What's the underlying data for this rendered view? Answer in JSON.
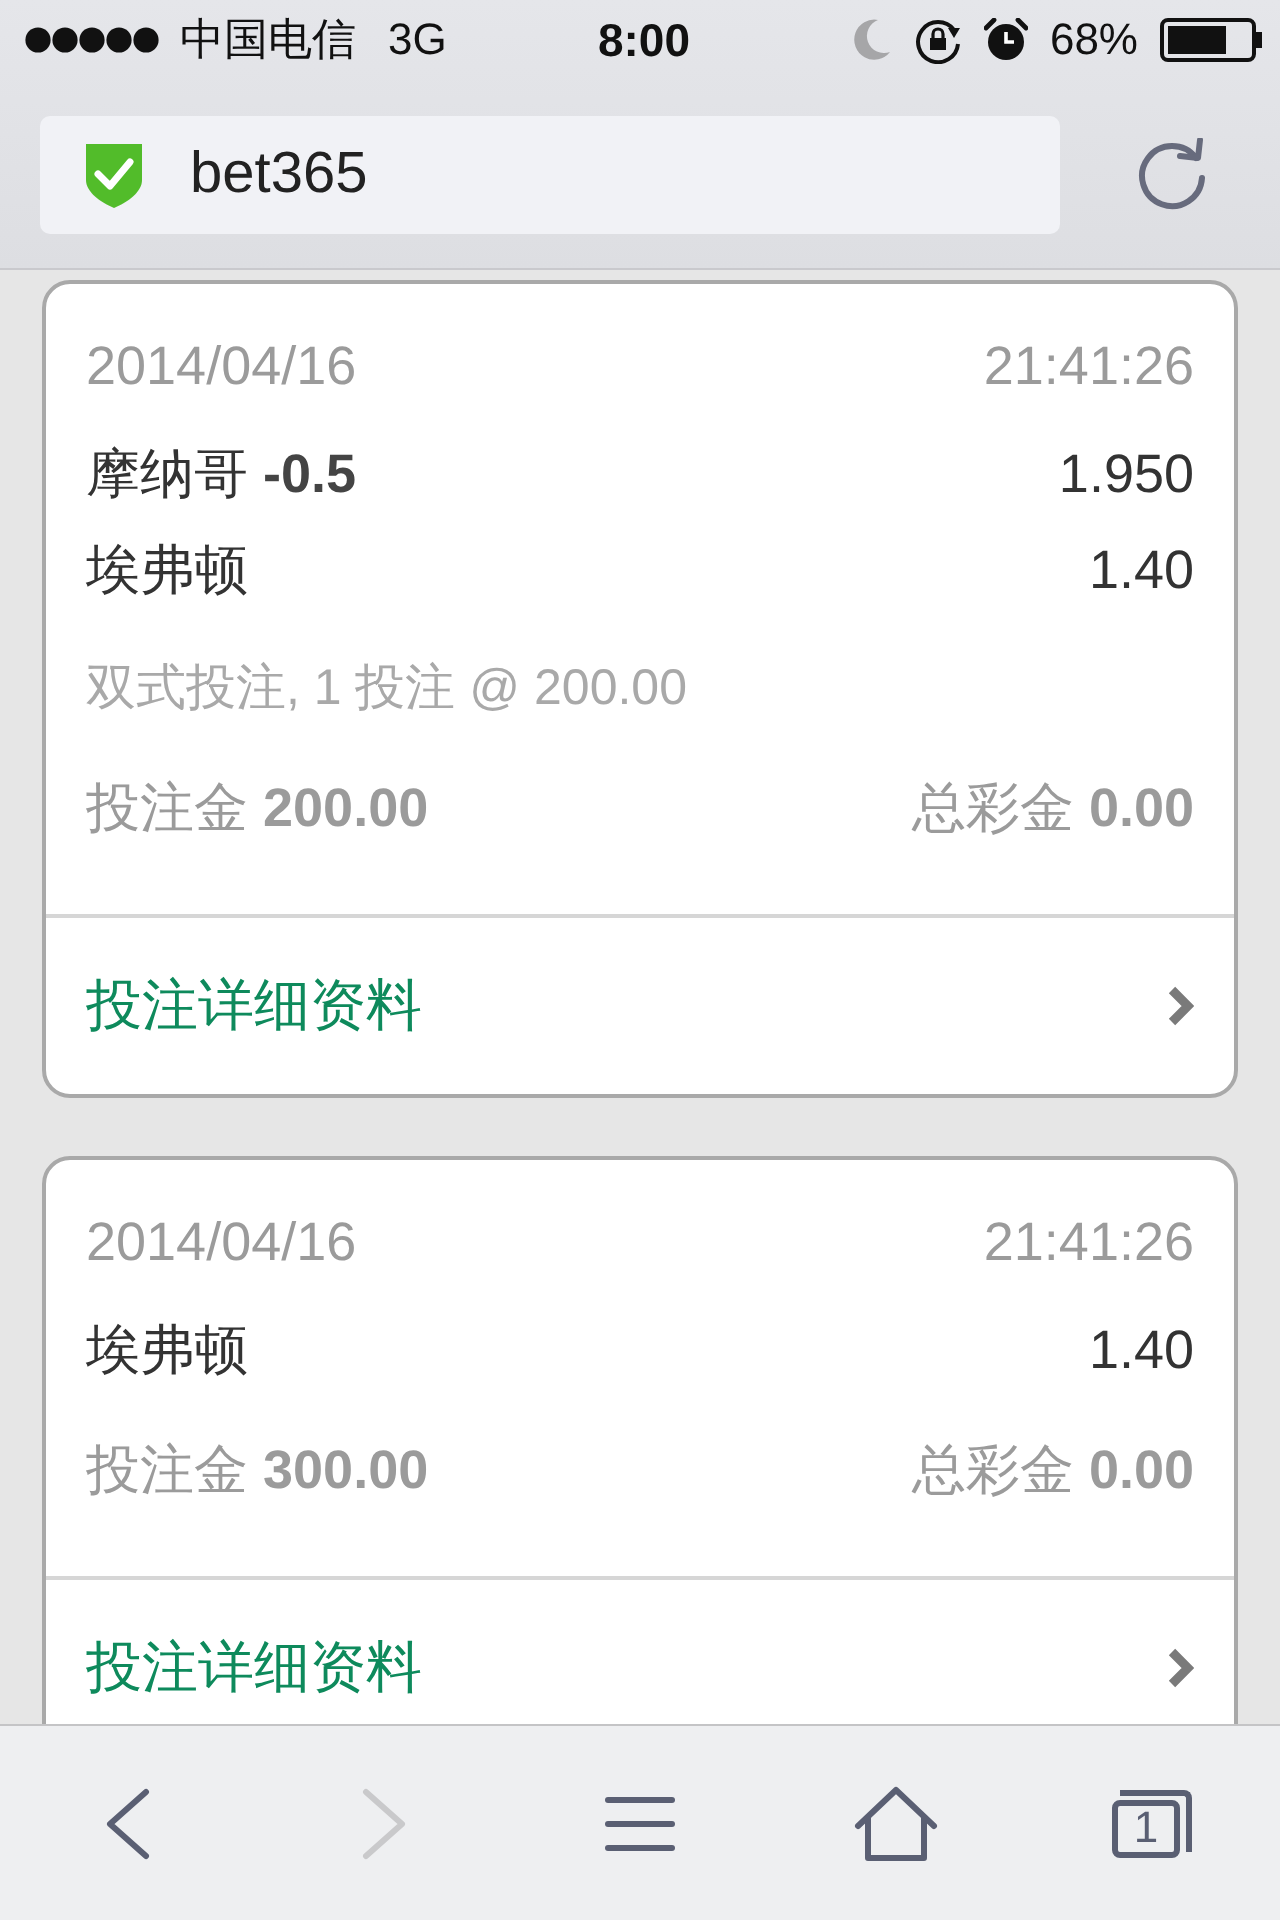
{
  "status_bar": {
    "carrier": "中国电信",
    "network": "3G",
    "time": "8:00",
    "battery": "68%"
  },
  "address_bar": {
    "url": "bet365",
    "secure": true
  },
  "bets": [
    {
      "date": "2014/04/16",
      "time": "21:41:26",
      "selections": [
        {
          "name": "摩纳哥 **-0.5**",
          "odds": "1.950"
        },
        {
          "name": "埃弗顿",
          "odds": "1.40"
        }
      ],
      "bet_type": "双式投注, 1 投注 @ 200.00",
      "stake": "投注金 **200.00**",
      "returns": "总彩金 **0.00**",
      "details_link": "投注详细资料"
    },
    {
      "date": "2014/04/16",
      "time": "21:41:26",
      "selections": [
        {
          "name": "埃弗顿",
          "odds": "1.40"
        }
      ],
      "stake": "投注金 **300.00**",
      "returns": "总彩金 **0.00**",
      "details_link": "投注详细资料"
    }
  ],
  "toolbar": [
    {
      "kind": "back",
      "disabled": false
    },
    {
      "kind": "forward",
      "disabled": true
    },
    {
      "kind": "menu",
      "disabled": false
    },
    {
      "kind": "home",
      "disabled": false
    },
    {
      "kind": "tabs",
      "disabled": false,
      "count": "1"
    }
  ]
}
